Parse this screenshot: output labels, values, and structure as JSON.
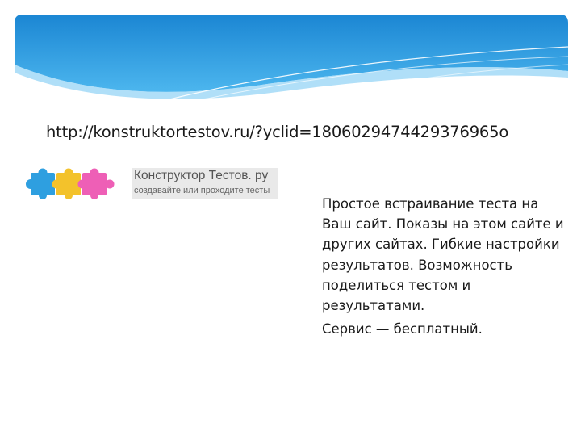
{
  "slide": {
    "url": "http://konstruktortestov.ru/?yclid=1806029474429376965o",
    "logo": {
      "title": "Конструктор Тестов. ру",
      "subtitle": "создавайте или проходите тесты"
    },
    "description": {
      "paragraph1": "Простое встраивание теста на Ваш сайт. Показы на этом сайте и других сайтах. Гибкие настройки результатов. Возможность поделиться тестом и результатами.",
      "paragraph2": "Сервис — бесплатный."
    }
  },
  "colors": {
    "banner_blue": "#1e8fd8",
    "puzzle_blue": "#2e9fe0",
    "puzzle_yellow": "#f3c22b",
    "puzzle_pink": "#ee5fb6"
  }
}
